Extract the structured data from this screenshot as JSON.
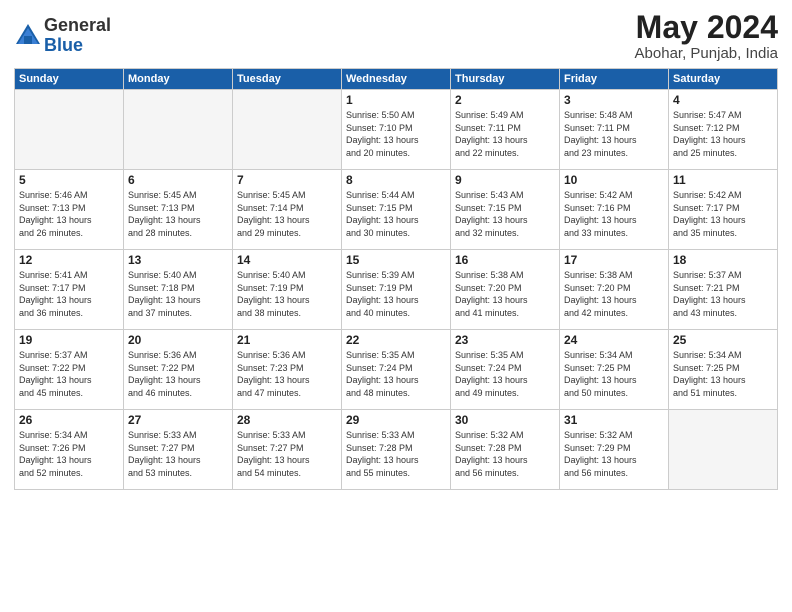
{
  "logo": {
    "general": "General",
    "blue": "Blue"
  },
  "title": "May 2024",
  "location": "Abohar, Punjab, India",
  "weekdays": [
    "Sunday",
    "Monday",
    "Tuesday",
    "Wednesday",
    "Thursday",
    "Friday",
    "Saturday"
  ],
  "weeks": [
    [
      {
        "day": "",
        "info": ""
      },
      {
        "day": "",
        "info": ""
      },
      {
        "day": "",
        "info": ""
      },
      {
        "day": "1",
        "info": "Sunrise: 5:50 AM\nSunset: 7:10 PM\nDaylight: 13 hours\nand 20 minutes."
      },
      {
        "day": "2",
        "info": "Sunrise: 5:49 AM\nSunset: 7:11 PM\nDaylight: 13 hours\nand 22 minutes."
      },
      {
        "day": "3",
        "info": "Sunrise: 5:48 AM\nSunset: 7:11 PM\nDaylight: 13 hours\nand 23 minutes."
      },
      {
        "day": "4",
        "info": "Sunrise: 5:47 AM\nSunset: 7:12 PM\nDaylight: 13 hours\nand 25 minutes."
      }
    ],
    [
      {
        "day": "5",
        "info": "Sunrise: 5:46 AM\nSunset: 7:13 PM\nDaylight: 13 hours\nand 26 minutes."
      },
      {
        "day": "6",
        "info": "Sunrise: 5:45 AM\nSunset: 7:13 PM\nDaylight: 13 hours\nand 28 minutes."
      },
      {
        "day": "7",
        "info": "Sunrise: 5:45 AM\nSunset: 7:14 PM\nDaylight: 13 hours\nand 29 minutes."
      },
      {
        "day": "8",
        "info": "Sunrise: 5:44 AM\nSunset: 7:15 PM\nDaylight: 13 hours\nand 30 minutes."
      },
      {
        "day": "9",
        "info": "Sunrise: 5:43 AM\nSunset: 7:15 PM\nDaylight: 13 hours\nand 32 minutes."
      },
      {
        "day": "10",
        "info": "Sunrise: 5:42 AM\nSunset: 7:16 PM\nDaylight: 13 hours\nand 33 minutes."
      },
      {
        "day": "11",
        "info": "Sunrise: 5:42 AM\nSunset: 7:17 PM\nDaylight: 13 hours\nand 35 minutes."
      }
    ],
    [
      {
        "day": "12",
        "info": "Sunrise: 5:41 AM\nSunset: 7:17 PM\nDaylight: 13 hours\nand 36 minutes."
      },
      {
        "day": "13",
        "info": "Sunrise: 5:40 AM\nSunset: 7:18 PM\nDaylight: 13 hours\nand 37 minutes."
      },
      {
        "day": "14",
        "info": "Sunrise: 5:40 AM\nSunset: 7:19 PM\nDaylight: 13 hours\nand 38 minutes."
      },
      {
        "day": "15",
        "info": "Sunrise: 5:39 AM\nSunset: 7:19 PM\nDaylight: 13 hours\nand 40 minutes."
      },
      {
        "day": "16",
        "info": "Sunrise: 5:38 AM\nSunset: 7:20 PM\nDaylight: 13 hours\nand 41 minutes."
      },
      {
        "day": "17",
        "info": "Sunrise: 5:38 AM\nSunset: 7:20 PM\nDaylight: 13 hours\nand 42 minutes."
      },
      {
        "day": "18",
        "info": "Sunrise: 5:37 AM\nSunset: 7:21 PM\nDaylight: 13 hours\nand 43 minutes."
      }
    ],
    [
      {
        "day": "19",
        "info": "Sunrise: 5:37 AM\nSunset: 7:22 PM\nDaylight: 13 hours\nand 45 minutes."
      },
      {
        "day": "20",
        "info": "Sunrise: 5:36 AM\nSunset: 7:22 PM\nDaylight: 13 hours\nand 46 minutes."
      },
      {
        "day": "21",
        "info": "Sunrise: 5:36 AM\nSunset: 7:23 PM\nDaylight: 13 hours\nand 47 minutes."
      },
      {
        "day": "22",
        "info": "Sunrise: 5:35 AM\nSunset: 7:24 PM\nDaylight: 13 hours\nand 48 minutes."
      },
      {
        "day": "23",
        "info": "Sunrise: 5:35 AM\nSunset: 7:24 PM\nDaylight: 13 hours\nand 49 minutes."
      },
      {
        "day": "24",
        "info": "Sunrise: 5:34 AM\nSunset: 7:25 PM\nDaylight: 13 hours\nand 50 minutes."
      },
      {
        "day": "25",
        "info": "Sunrise: 5:34 AM\nSunset: 7:25 PM\nDaylight: 13 hours\nand 51 minutes."
      }
    ],
    [
      {
        "day": "26",
        "info": "Sunrise: 5:34 AM\nSunset: 7:26 PM\nDaylight: 13 hours\nand 52 minutes."
      },
      {
        "day": "27",
        "info": "Sunrise: 5:33 AM\nSunset: 7:27 PM\nDaylight: 13 hours\nand 53 minutes."
      },
      {
        "day": "28",
        "info": "Sunrise: 5:33 AM\nSunset: 7:27 PM\nDaylight: 13 hours\nand 54 minutes."
      },
      {
        "day": "29",
        "info": "Sunrise: 5:33 AM\nSunset: 7:28 PM\nDaylight: 13 hours\nand 55 minutes."
      },
      {
        "day": "30",
        "info": "Sunrise: 5:32 AM\nSunset: 7:28 PM\nDaylight: 13 hours\nand 56 minutes."
      },
      {
        "day": "31",
        "info": "Sunrise: 5:32 AM\nSunset: 7:29 PM\nDaylight: 13 hours\nand 56 minutes."
      },
      {
        "day": "",
        "info": ""
      }
    ]
  ]
}
